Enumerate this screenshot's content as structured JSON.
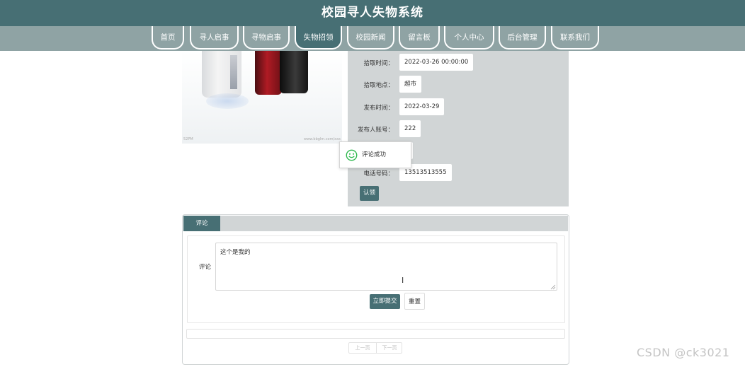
{
  "site": {
    "title": "校园寻人失物系统"
  },
  "nav": {
    "items": [
      "首页",
      "寻人启事",
      "寻物启事",
      "失物招领",
      "校园新闻",
      "留言板",
      "个人中心",
      "后台管理",
      "联系我们"
    ],
    "active_index": 3
  },
  "image": {
    "watermark_left": "52PM",
    "watermark_right": "www.bbglm.com/xxx"
  },
  "details": {
    "fields": [
      {
        "label": "拾取时间：",
        "value": "2022-03-26 00:00:00"
      },
      {
        "label": "拾取地点：",
        "value": "超市"
      },
      {
        "label": "发布时间：",
        "value": "2022-03-29"
      },
      {
        "label": "发布人账号：",
        "value": "222"
      },
      {
        "label": "",
        "value": "2"
      },
      {
        "label": "电话号码：",
        "value": "13513513555"
      }
    ],
    "claim_button": "认领"
  },
  "toast": {
    "text": "评论成功",
    "icon": "smiley-icon",
    "color": "#2db84d"
  },
  "comments": {
    "tab_label": "评论",
    "form_label": "评论",
    "textarea_value": "这个是我的",
    "submit_label": "立即提交",
    "reset_label": "重置",
    "pager": {
      "prev_label": "上一页",
      "next_label": "下一页"
    }
  },
  "watermark": "CSDN @ck3021",
  "colors": {
    "primary": "#476f74",
    "nav_bg": "#8fa3a4",
    "panel_bg": "#d1d5d6"
  }
}
